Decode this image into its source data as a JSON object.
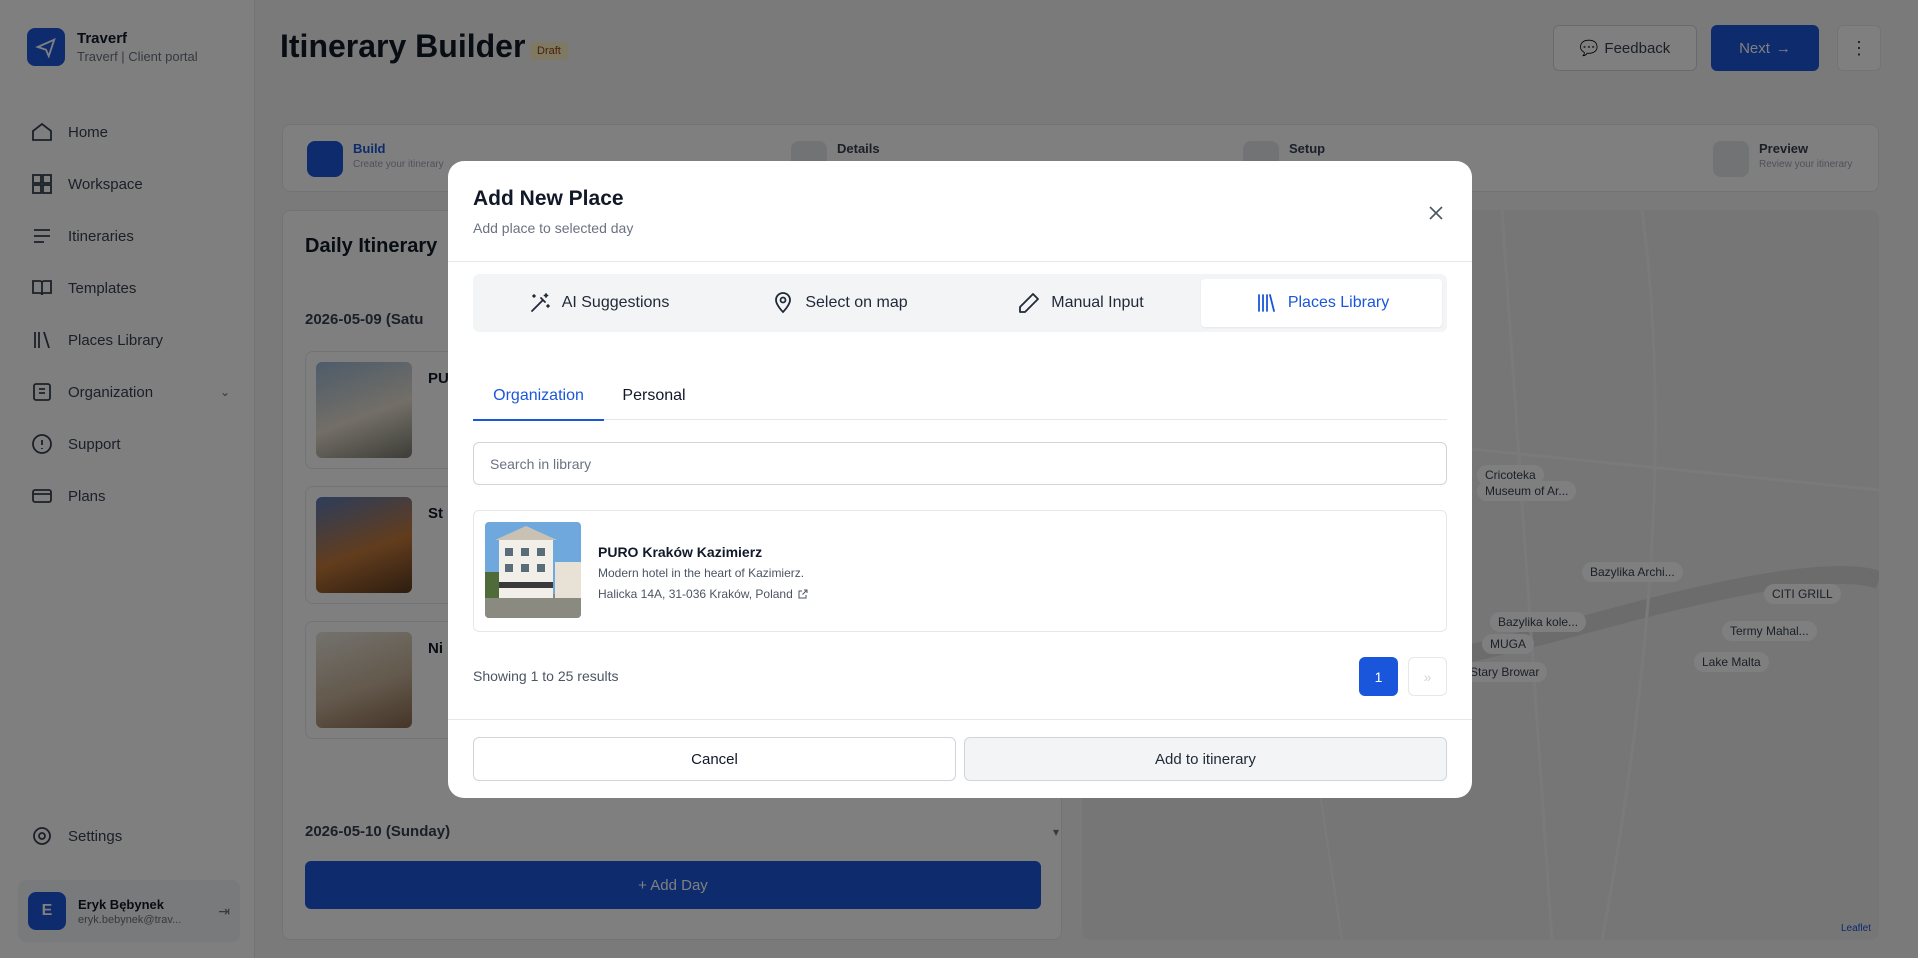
{
  "app": {
    "name": "Traverf",
    "subtitle": "Traverf | Client portal"
  },
  "sidebar": {
    "items": [
      {
        "label": "Home",
        "icon": "home-icon"
      },
      {
        "label": "Workspace",
        "icon": "workspace-icon"
      },
      {
        "label": "Itineraries",
        "icon": "itineraries-icon"
      },
      {
        "label": "Templates",
        "icon": "templates-icon"
      },
      {
        "label": "Places Library",
        "icon": "places-library-icon"
      },
      {
        "label": "Organization",
        "icon": "organization-icon"
      },
      {
        "label": "Support",
        "icon": "support-icon"
      },
      {
        "label": "Plans",
        "icon": "plans-icon"
      }
    ],
    "settings_label": "Settings",
    "user": {
      "initial": "E",
      "name": "Eryk Bębynek",
      "email": "eryk.bebynek@trav..."
    }
  },
  "header": {
    "title": "Itinerary Builder",
    "badge": "Draft",
    "feedback_label": "Feedback",
    "next_label": "Next"
  },
  "stepper": {
    "steps": [
      {
        "title": "Build",
        "subtitle": "Create your itinerary"
      },
      {
        "title": "Details",
        "subtitle": ""
      },
      {
        "title": "Setup",
        "subtitle": ""
      },
      {
        "title": "Preview",
        "subtitle": "Review your itinerary"
      }
    ]
  },
  "itinerary": {
    "title": "Daily Itinerary",
    "day1": "2026-05-09 (Satu",
    "day2": "2026-05-10 (Sunday)",
    "add_day_label": "+ Add Day",
    "cards": [
      "PU",
      "St",
      "Ni"
    ]
  },
  "map": {
    "labels": [
      "Cricoteka",
      "Museum of Ar...",
      "Bazylika Archi...",
      "Bazylika kole...",
      "MUGA",
      "Stary Browar",
      "CITI GRILL",
      "Termy Mahal...",
      "Lake Malta"
    ],
    "attribution": "Leaflet"
  },
  "modal": {
    "title": "Add New Place",
    "subtitle": "Add place to selected day",
    "mode_tabs": [
      {
        "label": "AI Suggestions",
        "icon": "magic-wand-icon"
      },
      {
        "label": "Select on map",
        "icon": "map-pin-icon"
      },
      {
        "label": "Manual Input",
        "icon": "pencil-icon"
      },
      {
        "label": "Places Library",
        "icon": "library-icon"
      }
    ],
    "active_mode": "Places Library",
    "sub_tabs": [
      "Organization",
      "Personal"
    ],
    "active_sub_tab": "Organization",
    "search_placeholder": "Search in library",
    "search_value": "",
    "results": [
      {
        "name": "PURO Kraków Kazimierz",
        "description": "Modern hotel in the heart of Kazimierz.",
        "address": "Halicka 14A, 31-036 Kraków, Poland"
      }
    ],
    "pagination": {
      "summary": "Showing 1 to 25 results",
      "current_page": "1",
      "next_label": "»"
    },
    "cancel_label": "Cancel",
    "add_label": "Add to itinerary"
  },
  "colors": {
    "accent": "#1a56db",
    "overlay": "rgba(0,0,0,0.5)"
  }
}
